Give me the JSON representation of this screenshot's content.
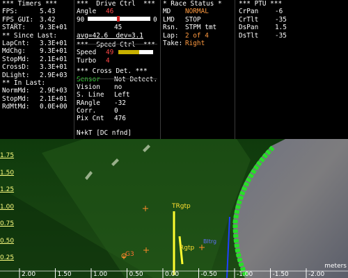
{
  "timers": {
    "header": "*** Timers ***",
    "rows": [
      {
        "label": "FPS:",
        "value": "5.43"
      },
      {
        "label": "FPS_GUI:",
        "value": "3.42"
      },
      {
        "label": "START:",
        "value": "9.3E+01"
      }
    ],
    "since_header": "** Since Last:",
    "since_rows": [
      {
        "label": "LapCnt:",
        "value": "3.3E+01"
      },
      {
        "label": "MdChg:",
        "value": "9.3E+01"
      },
      {
        "label": "StopMd:",
        "value": "2.1E+01"
      },
      {
        "label": "CrossD:",
        "value": "3.3E+01"
      },
      {
        "label": "DLight:",
        "value": "2.9E+03"
      }
    ],
    "in_header": "** In Last:",
    "in_rows": [
      {
        "label": "NormMd:",
        "value": "2.9E+03"
      },
      {
        "label": "StopMd:",
        "value": "2.1E+01"
      },
      {
        "label": "RdMtMd:",
        "value": "0.0E+00"
      }
    ]
  },
  "drive": {
    "header": "***  Drive Ctrl  ***",
    "angle_label": "Angle",
    "angle_value": "46",
    "slider_min": "90",
    "slider_max": "0",
    "slider_level": 0.49,
    "slider_current": "45",
    "stats": "avg=42.6  dev=3.1",
    "speed_header": "***  Speed Ctrl  ***",
    "speed_label": "Speed",
    "speed_value": "49",
    "speed_level": 0.6,
    "turbo_label": "Turbo",
    "turbo_value": "4",
    "cross_header": "*** Cross Det. ***",
    "cross_rows": [
      {
        "label": "Sensor",
        "value": "Not Detect."
      },
      {
        "label": "Vision",
        "value": "no"
      },
      {
        "label": "S. Line",
        "value": "Left"
      },
      {
        "label": "RAngle",
        "value": "-32"
      },
      {
        "label": "Corr.",
        "value": "0"
      },
      {
        "label": "Pix Cnt",
        "value": "476"
      }
    ],
    "nkt": "N+kT [DC nfnd]"
  },
  "race": {
    "header": "* Race Status *",
    "rows": [
      {
        "label": "MD",
        "value": "NORMAL"
      },
      {
        "label": "LMD",
        "value": "STOP"
      },
      {
        "label": "Rsn.",
        "value": "STPM tmt"
      },
      {
        "label": "Lap:",
        "value": "2 of 4"
      },
      {
        "label": "Take:",
        "value": "Right"
      }
    ]
  },
  "ptu": {
    "header": "*** PTU ***",
    "rows": [
      {
        "label": "CrPan",
        "value": "-6"
      },
      {
        "label": "CrTlt",
        "value": "-35"
      },
      {
        "label": "DsPan",
        "value": "1.5"
      },
      {
        "label": "DsTlt",
        "value": "-35"
      }
    ]
  },
  "scene": {
    "y_ticks": [
      "1.75",
      "1.50",
      "1.25",
      "1.00",
      "0.75",
      "0.50",
      "0.25"
    ],
    "x_ticks": [
      "2.00",
      "1.50",
      "1.00",
      "0.50",
      "0.00",
      "-0.50",
      "-1.00",
      "-1.50",
      "-2.00"
    ],
    "units": "meters",
    "labels": {
      "trgtp": "TRgtp",
      "rgtp": "Rgtp",
      "g3": "G3",
      "blue": "Bltrg"
    },
    "colors": {
      "ground": "#163d10",
      "boundary": "#28e028",
      "target": "#ffff30",
      "marker": "#ff8c2a",
      "blue": "#3040ff"
    }
  }
}
